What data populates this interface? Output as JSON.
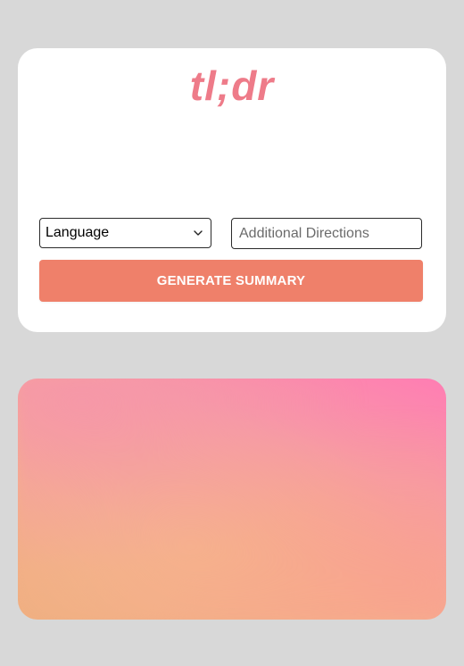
{
  "app": {
    "logo_text": "tl;dr"
  },
  "form": {
    "language_select": {
      "selected_label": "Language"
    },
    "directions_input": {
      "placeholder": "Additional Directions",
      "value": ""
    },
    "generate_button_label": "GENERATE SUMMARY"
  },
  "colors": {
    "page_background": "#d8d8d8",
    "card_background": "#ffffff",
    "logo": "#ee7b89",
    "button": "#ef806a",
    "gradient_pink": "#ff7db3",
    "gradient_peach": "#f0af81"
  },
  "icons": {
    "select_chevron": "chevron-down-icon"
  }
}
